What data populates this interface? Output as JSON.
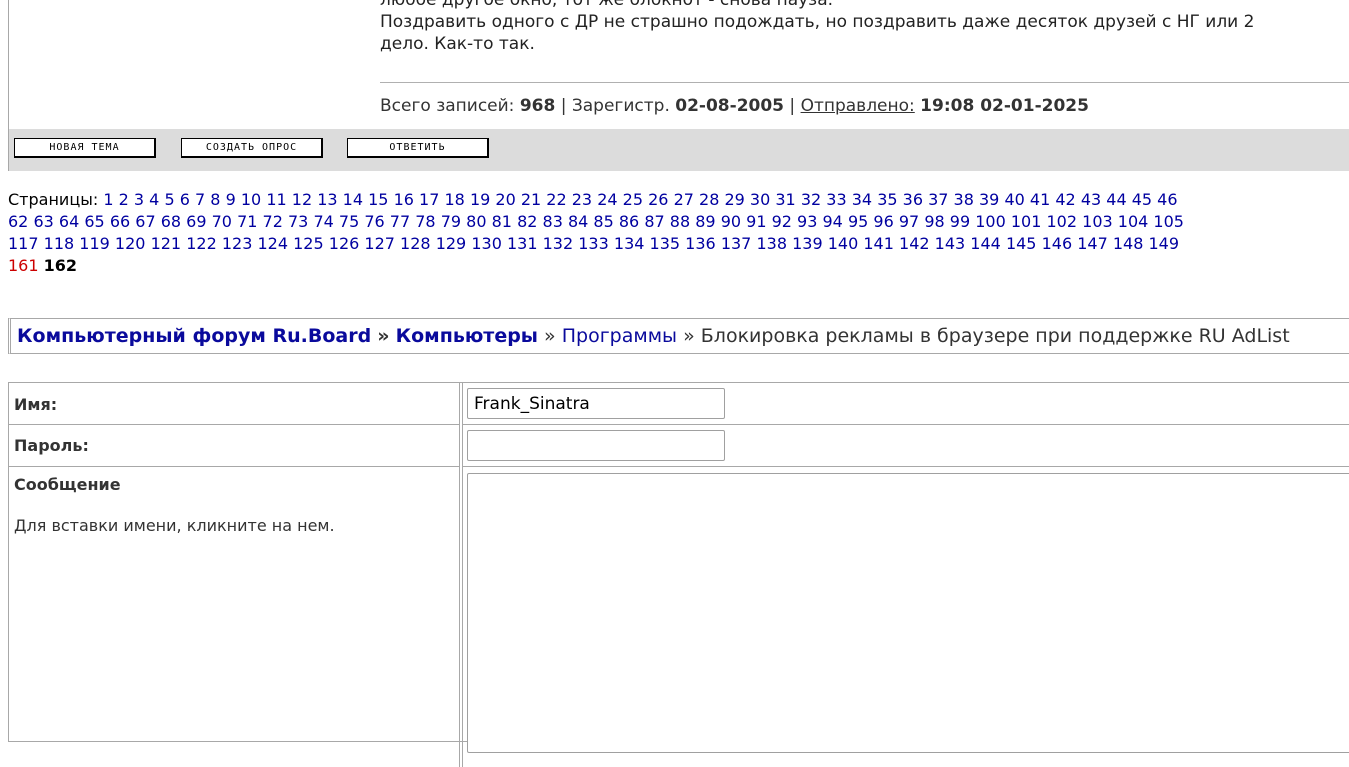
{
  "post": {
    "line1": "любое другое окно, тот же блокнот - снова пауза.",
    "line2": "Поздравить одного с ДР не страшно подождать, но поздравить даже десяток друзей с НГ или 2",
    "line3": "дело. Как-то так.",
    "meta": {
      "records_label": "Всего записей:",
      "records_value": "968",
      "sep1": "|",
      "reg_label": "Зарегистр.",
      "reg_value": "02-08-2005",
      "sep2": "|",
      "sent_label": "Отправлено:",
      "sent_value": "19:08 02-01-2025"
    }
  },
  "actions": {
    "new_topic": "НОВАЯ ТЕМА",
    "create_poll": "СОЗДАТЬ ОПРОС",
    "reply": "ОТВЕТИТЬ"
  },
  "pagination": {
    "label": "Страницы:",
    "row1": [
      "1",
      "2",
      "3",
      "4",
      "5",
      "6",
      "7",
      "8",
      "9",
      "10",
      "11",
      "12",
      "13",
      "14",
      "15",
      "16",
      "17",
      "18",
      "19",
      "20",
      "21",
      "22",
      "23",
      "24",
      "25",
      "26",
      "27",
      "28",
      "29",
      "30",
      "31",
      "32",
      "33",
      "34",
      "35",
      "36",
      "37",
      "38",
      "39",
      "40",
      "41",
      "42",
      "43",
      "44",
      "45",
      "46"
    ],
    "row2": [
      "62",
      "63",
      "64",
      "65",
      "66",
      "67",
      "68",
      "69",
      "70",
      "71",
      "72",
      "73",
      "74",
      "75",
      "76",
      "77",
      "78",
      "79",
      "80",
      "81",
      "82",
      "83",
      "84",
      "85",
      "86",
      "87",
      "88",
      "89",
      "90",
      "91",
      "92",
      "93",
      "94",
      "95",
      "96",
      "97",
      "98",
      "99",
      "100",
      "101",
      "102",
      "103",
      "104",
      "105"
    ],
    "row3": [
      "117",
      "118",
      "119",
      "120",
      "121",
      "122",
      "123",
      "124",
      "125",
      "126",
      "127",
      "128",
      "129",
      "130",
      "131",
      "132",
      "133",
      "134",
      "135",
      "136",
      "137",
      "138",
      "139",
      "140",
      "141",
      "142",
      "143",
      "144",
      "145",
      "146",
      "147",
      "148",
      "149"
    ],
    "visited_page": "161",
    "current_page": "162",
    "link_color": "#0000a0",
    "visited_color": "#cc0000"
  },
  "breadcrumb": {
    "forum": "Компьютерный форум Ru.Board",
    "sep1": "»",
    "category": "Компьютеры",
    "sep2": "»",
    "section": "Программы",
    "sep3": "»",
    "topic": "Блокировка рекламы в браузере при поддержке RU AdList"
  },
  "form": {
    "name_label": "Имя:",
    "name_value": "Frank_Sinatra",
    "password_label": "Пароль:",
    "password_value": "",
    "message_label": "Сообщение",
    "message_hint": "Для вставки имени, кликните на нем.",
    "message_value": ""
  }
}
